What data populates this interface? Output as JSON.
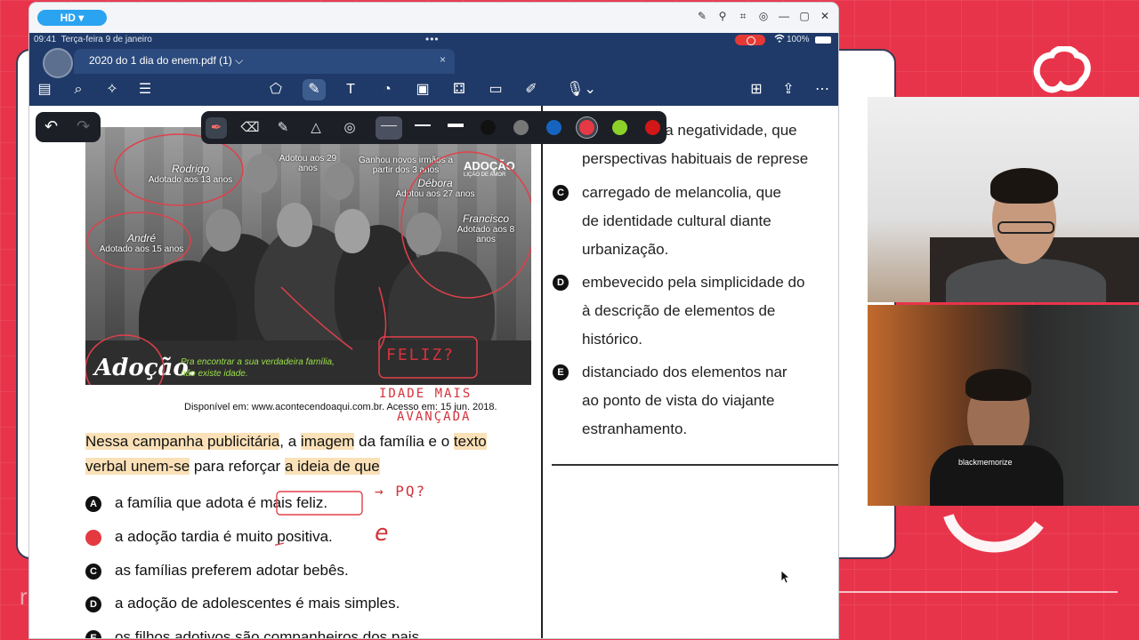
{
  "window": {
    "hd_badge": "HD ▾",
    "title_icons": [
      "pencil-icon",
      "pin-icon",
      "crop-icon",
      "target-icon",
      "minimize-icon",
      "maximize-icon",
      "close-icon"
    ]
  },
  "status": {
    "time": "09:41",
    "date": "Terça-feira 9 de janeiro",
    "dots": "•••",
    "battery": "100%"
  },
  "tab": {
    "name": "2020 do 1 dia do enem.pdf (1)",
    "chevron": "⌵",
    "close": "×"
  },
  "toolbar": {
    "left_tools": [
      "sidebar-icon",
      "search-icon",
      "sparkle-icon",
      "list-icon"
    ],
    "center_tools": [
      "shapes-icon",
      "pen-icon",
      "textbox-icon",
      "sticker-icon",
      "image-icon",
      "elements-icon",
      "note-icon",
      "laser-icon",
      "mic-icon"
    ],
    "right_tools": [
      "new-page-icon",
      "share-icon",
      "more-icon"
    ]
  },
  "pen_toolbar": {
    "colors": [
      "#111111",
      "#777777",
      "#1565c0",
      "#e53945",
      "#8bd12a",
      "#d11717"
    ]
  },
  "document": {
    "photo": {
      "brand": "ADOÇÃO",
      "brand_sub": "LIÇÃO DE AMOR",
      "logo": "Adoção.",
      "tagline": "Pra encontrar a sua verdadeira família, não existe idade.",
      "labels": [
        {
          "name": "Rodrigo",
          "text": "Adotado aos 13 anos"
        },
        {
          "name": "",
          "text": "Adotou aos 29 anos"
        },
        {
          "name": "",
          "text": "Ganhou novos irmãos a partir dos 3 anos"
        },
        {
          "name": "Débora",
          "text": "Adotou aos 27 anos"
        },
        {
          "name": "André",
          "text": "Adotado aos 15 anos"
        },
        {
          "name": "Francisco",
          "text": "Adotado aos 8 anos"
        }
      ]
    },
    "caption": "Disponível em: www.acontecendoaqui.com.br. Acesso em: 15 jun. 2018.",
    "handwritten": {
      "feliz": "FELIZ?",
      "idade_1": "IDADE MAIS",
      "idade_2": "AVANÇADA",
      "pq": "PQ?",
      "e": "e"
    },
    "question": {
      "p1": "Nessa campanha publicitária",
      "p2": ", a ",
      "p3": "imagem",
      "p4": " da família e o ",
      "p5": "texto verbal unem-se",
      "p6": " para reforçar ",
      "p7": "a ideia de que"
    },
    "options": [
      {
        "letter": "A",
        "text": "a família que adota é mais feliz."
      },
      {
        "letter": "B",
        "text": "a adoção tardia é muito positiva."
      },
      {
        "letter": "C",
        "text": "as famílias preferem adotar bebês."
      },
      {
        "letter": "D",
        "text": "a adoção de adolescentes é mais simples."
      },
      {
        "letter": "E",
        "text": "os filhos adotivos são companheiros dos pais."
      }
    ],
    "right_options": [
      {
        "letter": "",
        "lines": [
          "ela negatividade, que",
          "perspectivas habituais de represe"
        ]
      },
      {
        "letter": "C",
        "lines": [
          "carregado de melancolia, que",
          "de identidade cultural diante",
          "urbanização."
        ]
      },
      {
        "letter": "D",
        "lines": [
          "embevecido pela simplicidade do",
          "à descrição de elementos de",
          "histórico."
        ]
      },
      {
        "letter": "E",
        "lines": [
          "distanciado dos elementos nar",
          "ao ponto de vista do viajante",
          "estranhamento."
        ]
      }
    ]
  },
  "webcam": {
    "shirt_text": "blackmemorize"
  },
  "brand": {
    "accent": "#e8344a",
    "navy": "#1f3a68"
  }
}
